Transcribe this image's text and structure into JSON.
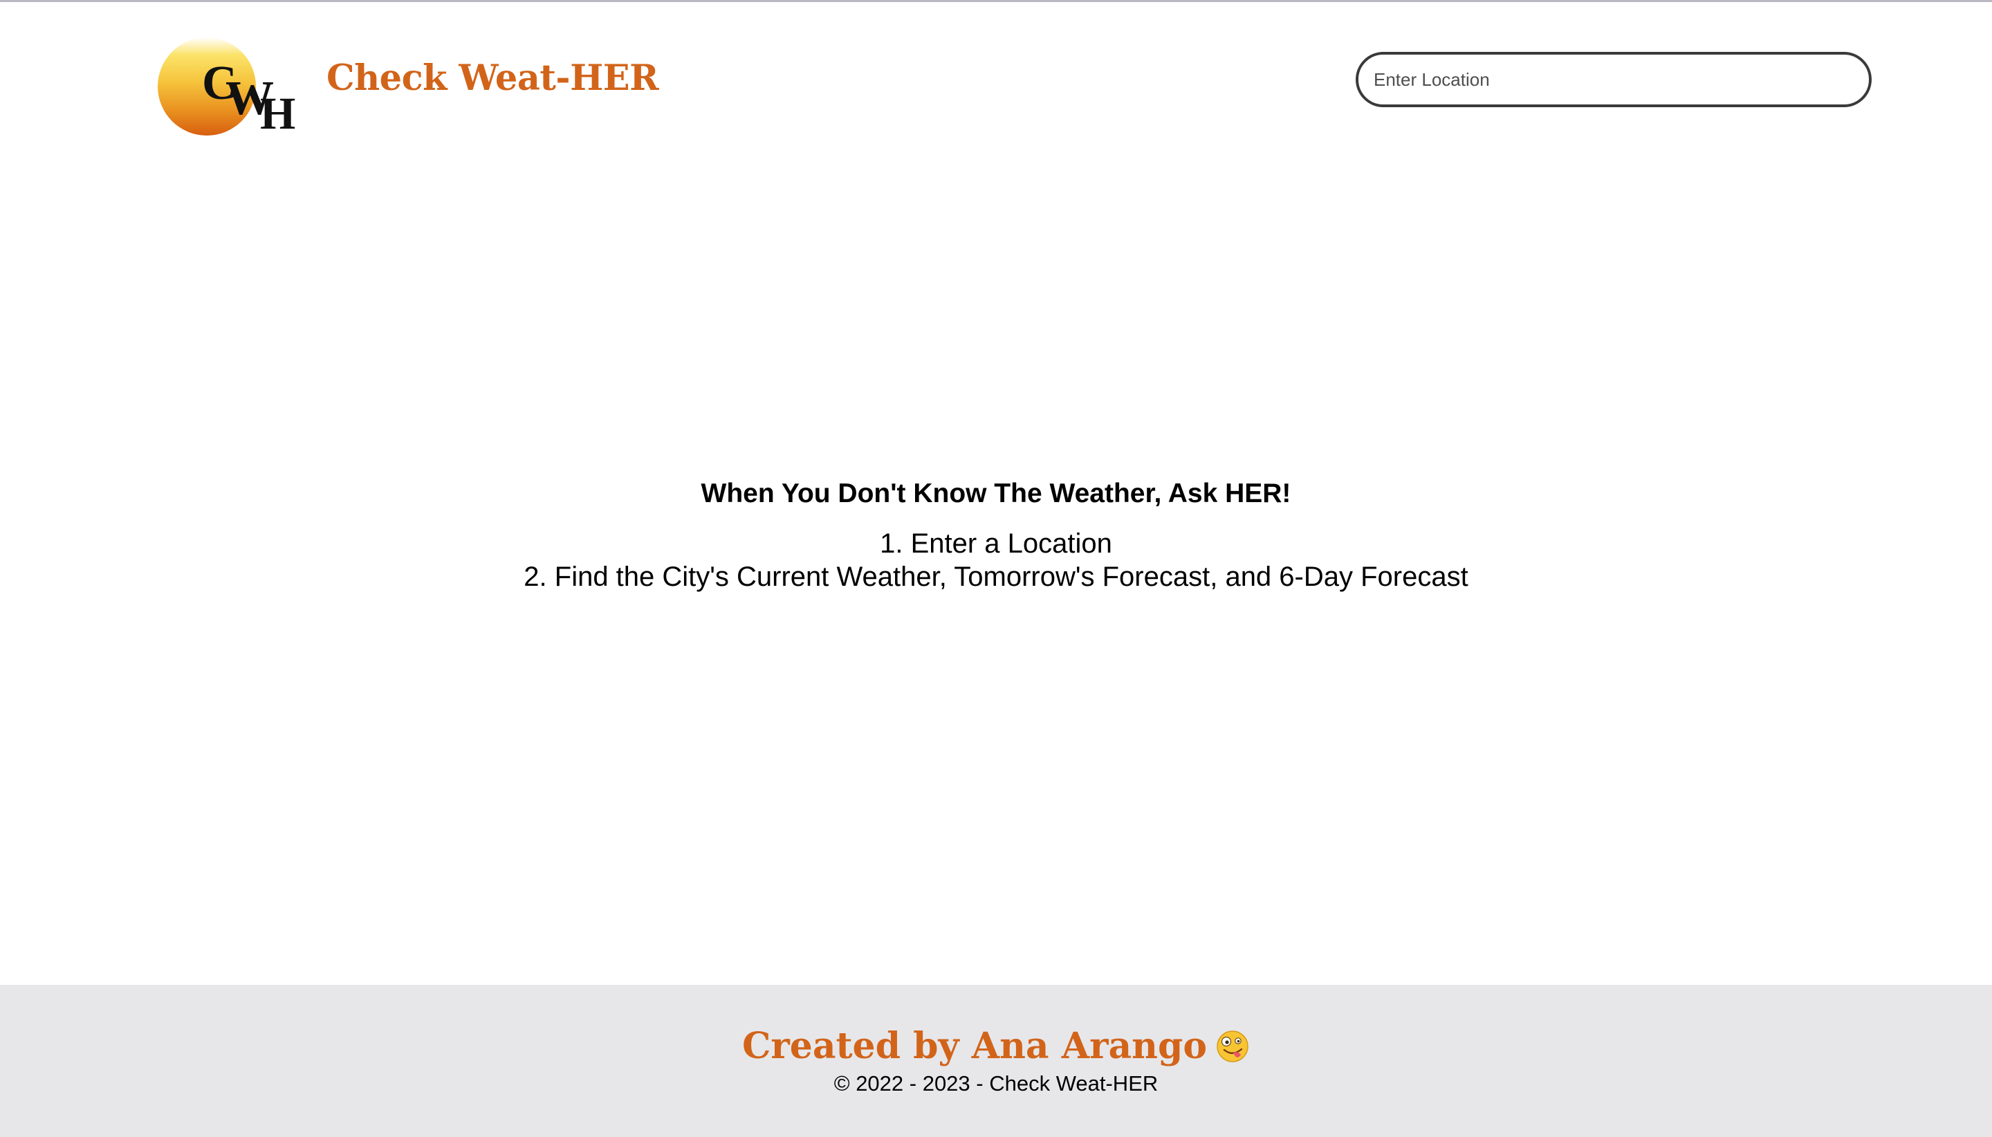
{
  "header": {
    "logo": {
      "letter_c": "C",
      "letter_w": "W",
      "letter_h": "H"
    },
    "title": "Check Weat-HER",
    "search": {
      "placeholder": "Enter Location",
      "value": ""
    }
  },
  "main": {
    "heading": "When You Don't Know The Weather, Ask HER!",
    "steps": [
      "1. Enter a Location",
      "2. Find the City's Current Weather, Tomorrow's Forecast, and 6-Day Forecast"
    ]
  },
  "footer": {
    "credit": "Created by Ana Arango",
    "emoji_icon": "zany-face-icon",
    "copyright": "© 2022 - 2023 - Check Weat-HER"
  },
  "colors": {
    "brand": "#d2641a",
    "footer_bg": "#e7e7ea",
    "sun_top": "#fbe36a",
    "sun_bottom": "#d85f10"
  }
}
